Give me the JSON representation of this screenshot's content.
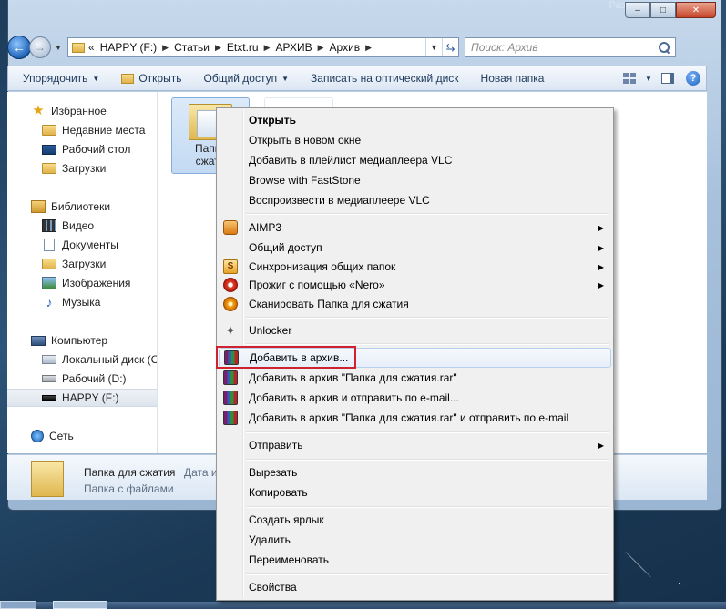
{
  "window": {
    "title_fragment": "Разд..."
  },
  "nav": {
    "address_segments": [
      "HAPPY (F:)",
      "Статьи",
      "Etxt.ru",
      "АРХИВ",
      "Архив"
    ],
    "address_prefix": "«",
    "search_placeholder": "Поиск: Архив"
  },
  "toolbar": {
    "organize": "Упорядочить",
    "open": "Открыть",
    "share": "Общий доступ",
    "burn": "Записать на оптический диск",
    "new_folder": "Новая папка"
  },
  "sidebar": {
    "favorites": "Избранное",
    "recent": "Недавние места",
    "desktop": "Рабочий стол",
    "downloads": "Загрузки",
    "libraries": "Библиотеки",
    "video": "Видео",
    "documents": "Документы",
    "lib_downloads": "Загрузки",
    "images": "Изображения",
    "music": "Музыка",
    "computer": "Компьютер",
    "local_disk": "Локальный диск (C",
    "work_disk": "Рабочий (D:)",
    "happy": "HAPPY (F:)",
    "network": "Сеть"
  },
  "content": {
    "folder_name_line1": "Папка",
    "folder_name_line2": "сжати"
  },
  "details": {
    "name": "Папка для сжатия",
    "date_label": "Дата и",
    "type": "Папка с файлами"
  },
  "menu": {
    "open": "Открыть",
    "open_new_window": "Открыть в новом окне",
    "add_vlc_playlist": "Добавить в плейлист медиаплеера VLC",
    "browse_faststone": "Browse with FastStone",
    "play_vlc": "Воспроизвести в медиаплеере VLC",
    "aimp": "AIMP3",
    "share": "Общий доступ",
    "sync": "Синхронизация общих папок",
    "nero": "Прожиг с помощью «Nero»",
    "scan": "Сканировать Папка для сжатия",
    "unlocker": "Unlocker",
    "add_archive": "Добавить в архив...",
    "add_archive_rar": "Добавить в архив \"Папка для сжатия.rar\"",
    "add_archive_email": "Добавить в архив и отправить по e-mail...",
    "add_archive_rar_email": "Добавить в архив \"Папка для сжатия.rar\" и отправить по e-mail",
    "send_to": "Отправить",
    "cut": "Вырезать",
    "copy": "Копировать",
    "create_shortcut": "Создать ярлык",
    "delete": "Удалить",
    "rename": "Переименовать",
    "properties": "Свойства"
  },
  "colors": {
    "highlight_box": "#d0222c",
    "hover_bg": "#e6eef9",
    "selection_border": "#84acdd"
  }
}
